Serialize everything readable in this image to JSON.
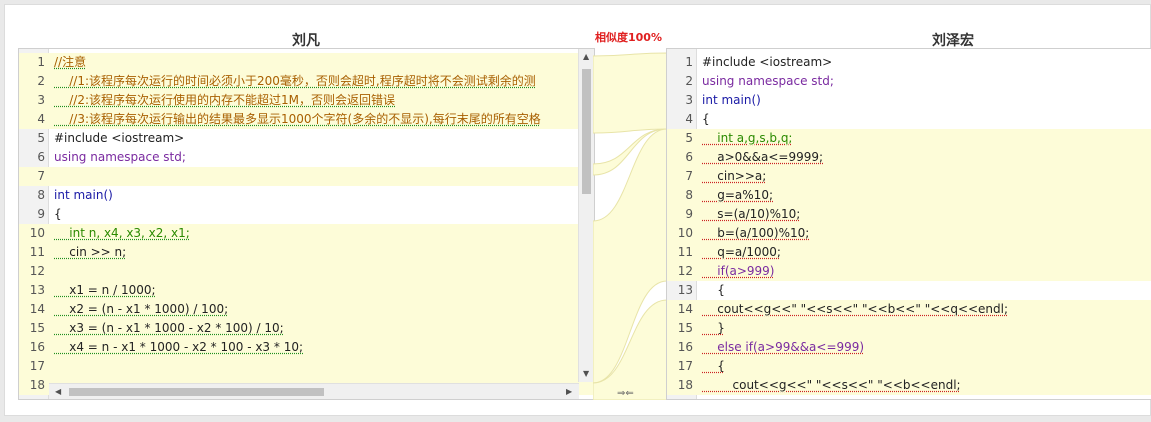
{
  "similarity_label": "相似度100%",
  "left": {
    "title": "刘凡",
    "lines": [
      {
        "n": "1",
        "text": "//注意",
        "cls": "c-comment",
        "hl": true
      },
      {
        "n": "2",
        "text": "    //1:该程序每次运行的时间必须小于200毫秒，否则会超时,程序超时将不会测试剩余的测",
        "cls": "c-comment",
        "hl": true
      },
      {
        "n": "3",
        "text": "    //2:该程序每次运行使用的内存不能超过1M，否则会返回错误",
        "cls": "c-comment",
        "hl": true
      },
      {
        "n": "4",
        "text": "    //3:该程序每次运行输出的结果最多显示1000个字符(多余的不显示),每行末尾的所有空格",
        "cls": "c-comment",
        "hl": true
      },
      {
        "n": "5",
        "text": "#include <iostream>",
        "cls": "c-dark",
        "hl": false
      },
      {
        "n": "6",
        "text": "using namespace std;",
        "cls": "c-purple",
        "hl": false
      },
      {
        "n": "7",
        "text": "",
        "cls": "c-dark",
        "hl": true
      },
      {
        "n": "8",
        "text": "int main()",
        "cls": "c-blue",
        "hl": false
      },
      {
        "n": "9",
        "text": "{",
        "cls": "c-dark",
        "hl": false
      },
      {
        "n": "10",
        "text": "    int n, x4, x3, x2, x1;",
        "cls": "c-green",
        "hl": true
      },
      {
        "n": "11",
        "text": "    cin >> n;",
        "cls": "c-dark",
        "hl": true
      },
      {
        "n": "12",
        "text": "",
        "cls": "c-dark",
        "hl": true
      },
      {
        "n": "13",
        "text": "    x1 = n / 1000;",
        "cls": "c-dark",
        "hl": true
      },
      {
        "n": "14",
        "text": "    x2 = (n - x1 * 1000) / 100;",
        "cls": "c-dark",
        "hl": true
      },
      {
        "n": "15",
        "text": "    x3 = (n - x1 * 1000 - x2 * 100) / 10;",
        "cls": "c-dark",
        "hl": true
      },
      {
        "n": "16",
        "text": "    x4 = n - x1 * 1000 - x2 * 100 - x3 * 10;",
        "cls": "c-dark",
        "hl": true
      },
      {
        "n": "17",
        "text": "",
        "cls": "c-dark",
        "hl": true
      },
      {
        "n": "18",
        "text": "",
        "cls": "c-dark",
        "hl": true
      }
    ]
  },
  "right": {
    "title": "刘泽宏",
    "lines": [
      {
        "n": "1",
        "text": "#include <iostream>",
        "cls": "c-dark",
        "hl": false
      },
      {
        "n": "2",
        "text": "using namespace std;",
        "cls": "c-purple",
        "hl": false
      },
      {
        "n": "3",
        "text": "int main()",
        "cls": "c-blue",
        "hl": false
      },
      {
        "n": "4",
        "text": "{",
        "cls": "c-dark",
        "hl": false
      },
      {
        "n": "5",
        "text": "    int a,g,s,b,q;",
        "cls": "c-green",
        "hl": true
      },
      {
        "n": "6",
        "text": "    a>0&&a<=9999;",
        "cls": "c-dark",
        "hl": true
      },
      {
        "n": "7",
        "text": "    cin>>a;",
        "cls": "c-dark",
        "hl": true
      },
      {
        "n": "8",
        "text": "    g=a%10;",
        "cls": "c-dark",
        "hl": true
      },
      {
        "n": "9",
        "text": "    s=(a/10)%10;",
        "cls": "c-dark",
        "hl": true
      },
      {
        "n": "10",
        "text": "    b=(a/100)%10;",
        "cls": "c-dark",
        "hl": true
      },
      {
        "n": "11",
        "text": "    q=a/1000;",
        "cls": "c-dark",
        "hl": true
      },
      {
        "n": "12",
        "text": "    if(a>999)",
        "cls": "c-purple",
        "hl": true
      },
      {
        "n": "13",
        "text": "    {",
        "cls": "c-dark",
        "hl": false
      },
      {
        "n": "14",
        "text": "    cout<<g<<\" \"<<s<<\" \"<<b<<\" \"<<q<<endl;",
        "cls": "c-dark",
        "hl": true
      },
      {
        "n": "15",
        "text": "    }",
        "cls": "c-dark",
        "hl": true
      },
      {
        "n": "16",
        "text": "    else if(a>99&&a<=999)",
        "cls": "c-purple",
        "hl": true
      },
      {
        "n": "17",
        "text": "    {",
        "cls": "c-dark",
        "hl": true
      },
      {
        "n": "18",
        "text": "        cout<<g<<\" \"<<s<<\" \"<<b<<endl;",
        "cls": "c-dark",
        "hl": true
      }
    ]
  },
  "icons": {
    "scroll_up": "arrow-up-icon",
    "scroll_down": "arrow-down-icon",
    "scroll_left": "arrow-left-icon",
    "scroll_right": "arrow-right-icon",
    "merge": "merge-arrows-icon"
  },
  "colors": {
    "similarity": "#e02020",
    "diff_highlight": "#fdfcd8",
    "comment": "#a85f00"
  }
}
